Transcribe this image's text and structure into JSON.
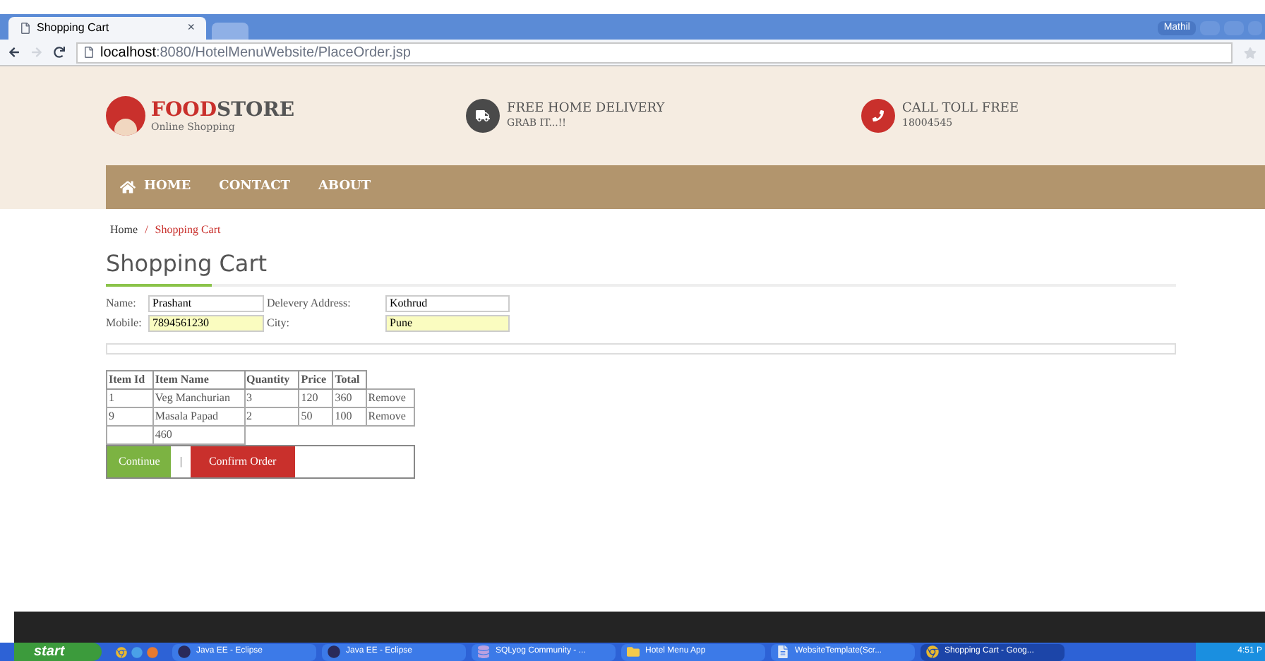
{
  "browser": {
    "tab_title": "Shopping Cart",
    "tab_close": "×",
    "url_host": "localhost",
    "url_path": ":8080/HotelMenuWebsite/PlaceOrder.jsp",
    "profile": "Mathil"
  },
  "header": {
    "brand": {
      "name_first": "FOOD",
      "name_second": "STORE",
      "tagline": "Online Shopping"
    },
    "features": [
      {
        "kind": "delivery",
        "title": "FREE HOME DELIVERY",
        "subtitle": "GRAB IT...!!"
      },
      {
        "kind": "phone",
        "title": "CALL TOLL FREE",
        "subtitle": "18004545"
      }
    ]
  },
  "nav": [
    {
      "label": "HOME",
      "kind": "home"
    },
    {
      "label": "CONTACT",
      "kind": "plain"
    },
    {
      "label": "ABOUT",
      "kind": "plain"
    }
  ],
  "breadcrumb": {
    "separator": "/",
    "items": [
      {
        "label": "Home",
        "selected": false
      },
      {
        "label": "Shopping Cart",
        "selected": true
      }
    ]
  },
  "page_title": "Shopping Cart",
  "form": {
    "fields": [
      {
        "label": "Name:",
        "value": "Prashant",
        "highlighted": false
      },
      {
        "label": "Delevery Address:",
        "value": "Kothrud",
        "highlighted": false
      },
      {
        "label": "Mobile:",
        "value": "7894561230",
        "highlighted": true
      },
      {
        "label": "City:",
        "value": "Pune",
        "highlighted": true
      }
    ]
  },
  "table": {
    "columns": [
      "Item Id",
      "Item Name",
      "Quantity",
      "Price",
      "Total"
    ],
    "rows": [
      {
        "cells": [
          "1",
          "Veg Manchurian",
          "3",
          "120",
          "360"
        ],
        "action": "Remove"
      },
      {
        "cells": [
          "9",
          "Masala Papad",
          "2",
          "50",
          "100"
        ],
        "action": "Remove"
      }
    ],
    "grand_total": "460"
  },
  "actions": {
    "separator": "|",
    "buttons": [
      {
        "label": "Continue",
        "kind": "continue"
      },
      {
        "label": "Confirm Order",
        "kind": "confirm"
      }
    ]
  },
  "taskbar": {
    "start": "start",
    "tasks": [
      {
        "label": "Java EE - Eclipse",
        "kind": "eclipse",
        "selected": false
      },
      {
        "label": "Java EE - Eclipse",
        "kind": "eclipse",
        "selected": false
      },
      {
        "label": "SQLyog Community - ...",
        "kind": "db",
        "selected": false
      },
      {
        "label": "Hotel Menu App",
        "kind": "folder",
        "selected": false
      },
      {
        "label": "WebsiteTemplate(Scr...",
        "kind": "doc",
        "selected": false
      },
      {
        "label": "Shopping Cart - Goog...",
        "kind": "browser",
        "selected": true
      }
    ],
    "clock": "4:51 P"
  }
}
